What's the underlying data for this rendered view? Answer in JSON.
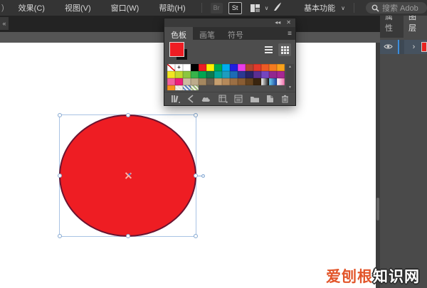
{
  "menubar": {
    "fragment": ")",
    "items": [
      "效果(C)",
      "视图(V)",
      "窗口(W)",
      "帮助(H)"
    ],
    "br_badge": "Br",
    "st_badge": "St",
    "workspace_label": "基本功能",
    "workspace_caret": "∨",
    "search_placeholder": "搜索 Adob",
    "icons": [
      "bridge-icon",
      "stock-icon",
      "workspace-layout-icon",
      "chevron-down-icon",
      "brush-icon",
      "search-icon"
    ]
  },
  "docbar": {
    "collapse_glyph": "«"
  },
  "swatches_panel": {
    "collapse_glyph": "◂◂",
    "close_glyph": "✕",
    "tabs": [
      {
        "label": "色板",
        "active": true
      },
      {
        "label": "画笔",
        "active": false
      },
      {
        "label": "符号",
        "active": false
      }
    ],
    "menu_glyph": "≡",
    "fill_color": "#ee1d23",
    "scroll_up_glyph": "▲",
    "scroll_down_glyph": "▼",
    "rows": [
      [
        "none",
        "reg",
        "#ffffff",
        "#000000",
        "#ed1c24",
        "#fff200",
        "#00a94f",
        "#00adef",
        "#1f1fe0",
        "#e93ce9",
        "#b0452f",
        "#e2392b",
        "#ee5a24",
        "#f47b20",
        "#f9a21b"
      ],
      [
        "#f2e522",
        "#c2d72e",
        "#8cc63f",
        "#37b34a",
        "#00a551",
        "#0d7a4d",
        "#00a79a",
        "#1d9dbf",
        "#1c6cb5",
        "#2b3990",
        "#272266",
        "#5b2e91",
        "#7445c0",
        "#92278f",
        "#a82693"
      ],
      [
        "#f0609e",
        "#ed1e79",
        "#ccbda1",
        "#bcab8b",
        "#a5875f",
        "#6b5e50",
        "#c79f6f",
        "#b5895a",
        "#9c6f44",
        "#8a5d33",
        "#65431f",
        "#3a250f",
        "lg:#ffffff,#111111",
        "lg:#6fd3f2,#1c3f9b",
        "lg:#ffffff,#f06eaa"
      ],
      [
        "#f7941d",
        "pat:#e8e4d8",
        "pat:#5b84c4",
        "pat:#9ab87a"
      ]
    ],
    "bottom_icons": [
      "swatch-libraries-icon",
      "color-themes-icon",
      "add-to-library-icon",
      "swatch-kinds-icon",
      "swatch-options-icon",
      "new-color-group-icon",
      "new-swatch-icon",
      "delete-swatch-icon"
    ]
  },
  "right_panel": {
    "tabs": [
      {
        "label": "属性",
        "active": false
      },
      {
        "label": "图层",
        "active": true
      }
    ],
    "layer_expand_glyph": "›",
    "layer_thumb_color": "#e8231f",
    "icons": [
      "eye-icon"
    ]
  },
  "canvas": {
    "shape": "ellipse",
    "ellipse_fill": "#ee1d23"
  },
  "watermark": {
    "left": "爱刨根",
    "right": "知识网",
    "accent_color": "#e2562b"
  }
}
